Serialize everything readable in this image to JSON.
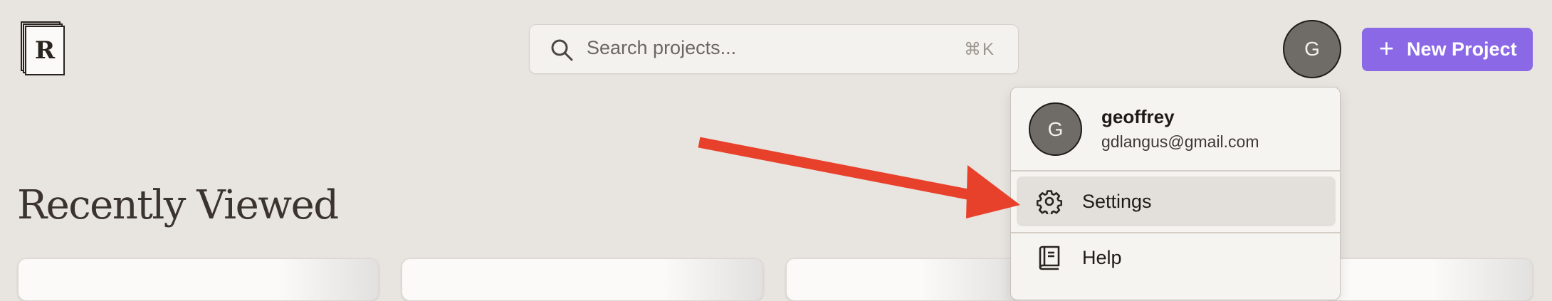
{
  "logo": {
    "letter": "R"
  },
  "search": {
    "placeholder": "Search projects...",
    "shortcut": "⌘K"
  },
  "user": {
    "initial": "G",
    "name": "geoffrey",
    "email": "gdlangus@gmail.com"
  },
  "new_project": {
    "label": "New Project",
    "icon": "plus-icon"
  },
  "section": {
    "title": "Recently Viewed"
  },
  "menu": {
    "items": [
      {
        "label": "Settings",
        "icon": "gear-icon",
        "active": true
      },
      {
        "label": "Help",
        "icon": "book-icon",
        "active": false
      }
    ]
  },
  "colors": {
    "accent": "#8a68e6",
    "annotation_arrow": "#e8412b",
    "background": "#e8e4e0"
  }
}
